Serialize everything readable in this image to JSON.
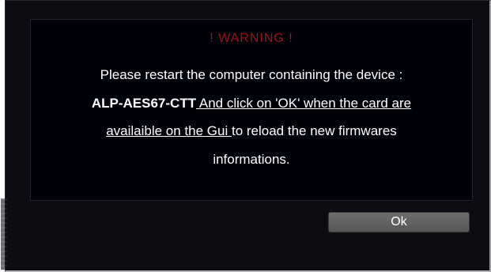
{
  "dialog": {
    "title": "! WARNING !",
    "message": {
      "line1": "Please restart the computer containing the device :",
      "device": "ALP-AES67-CTT",
      "link1": " And click on 'OK' when the card are",
      "link2": "availaible on the Gui ",
      "rest": "to reload the new firmwares",
      "line4": "informations."
    },
    "ok_label": "Ok"
  },
  "colors": {
    "background": "#0c0c12",
    "panel": "#000008",
    "warning": "#a01414",
    "text": "#ffffff",
    "button": "#606060"
  }
}
